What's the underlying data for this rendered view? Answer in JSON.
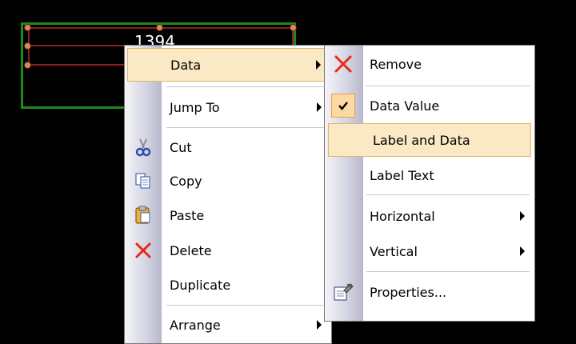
{
  "canvas": {
    "label": "1394"
  },
  "main_menu": {
    "items": [
      {
        "label": "Data",
        "submenu": true
      },
      {
        "label": "Jump To",
        "submenu": true
      },
      {
        "label": "Cut",
        "icon": "scissors-icon"
      },
      {
        "label": "Copy",
        "icon": "copy-icon"
      },
      {
        "label": "Paste",
        "icon": "paste-icon"
      },
      {
        "label": "Delete",
        "icon": "delete-x-icon"
      },
      {
        "label": "Duplicate"
      },
      {
        "label": "Arrange",
        "submenu": true
      }
    ]
  },
  "sub_menu": {
    "items": [
      {
        "label": "Remove",
        "icon": "remove-x-icon"
      },
      {
        "label": "Data Value",
        "checked": true
      },
      {
        "label": "Label and Data"
      },
      {
        "label": "Label Text"
      },
      {
        "label": "Horizontal",
        "submenu": true
      },
      {
        "label": "Vertical",
        "submenu": true
      },
      {
        "label": "Properties...",
        "icon": "properties-icon"
      }
    ]
  },
  "colors": {
    "highlight": "#fbe8c4",
    "highlight_border": "#e1b46a",
    "object_green": "#1e8a1e",
    "object_red": "#8a2020",
    "delete_red": "#e8281a"
  }
}
